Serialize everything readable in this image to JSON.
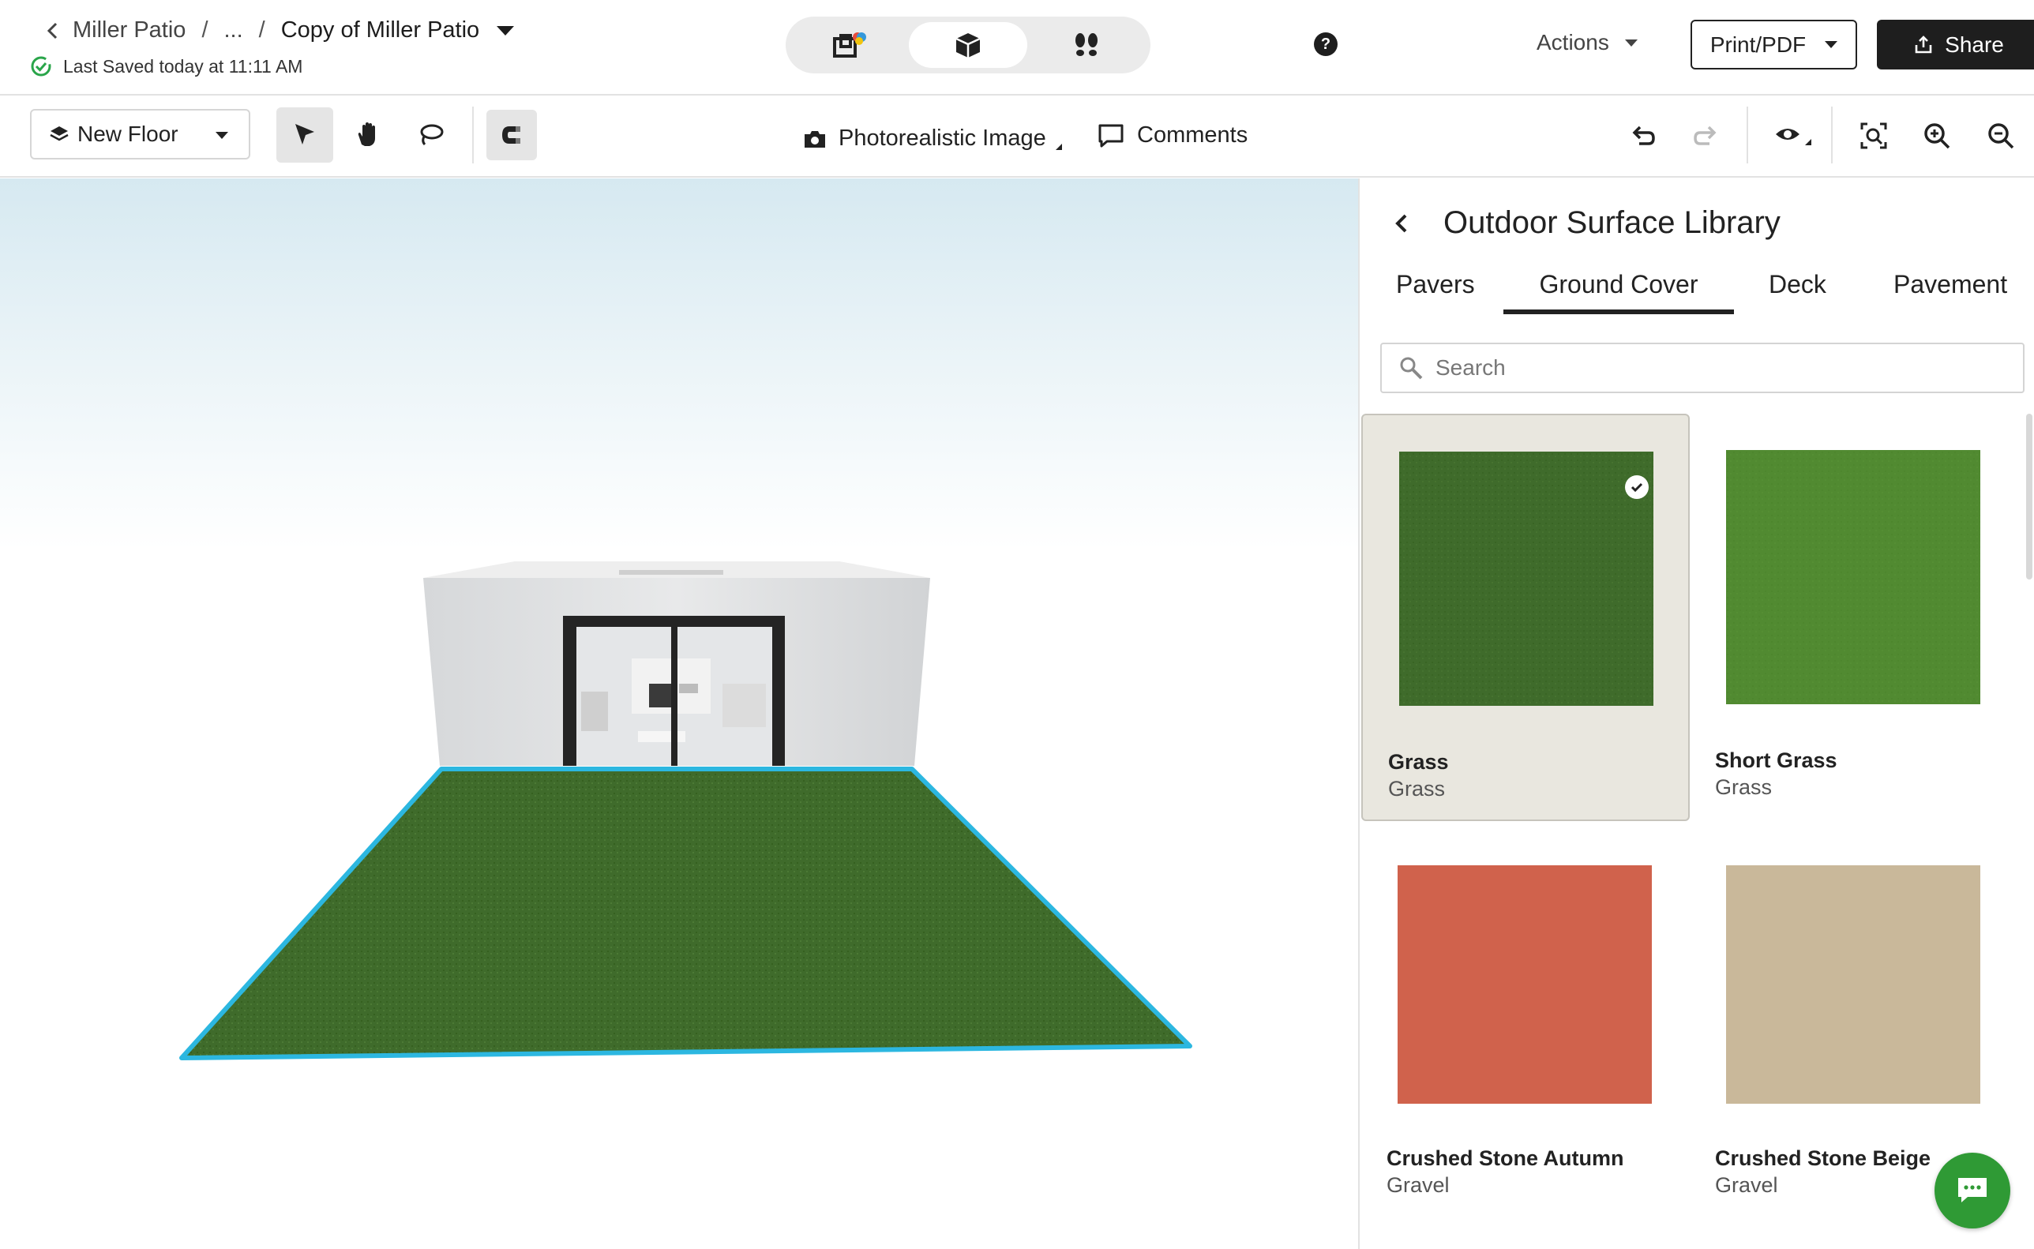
{
  "header": {
    "breadcrumb_parent": "Miller Patio",
    "breadcrumb_ellipsis": "...",
    "breadcrumb_separator": "/",
    "project_title": "Copy of Miller Patio",
    "save_status": "Last Saved today at 11:11 AM",
    "mode_icons": [
      "2d-floorplan-icon",
      "3d-box-icon",
      "walkthrough-footsteps-icon"
    ],
    "active_mode": "3d-box-icon",
    "help_label": "?",
    "actions_label": "Actions",
    "print_label": "Print/PDF",
    "share_label": "Share"
  },
  "toolbar": {
    "floor_label": "New Floor",
    "photo_label": "Photorealistic Image",
    "comments_label": "Comments"
  },
  "panel": {
    "title": "Outdoor Surface Library",
    "tabs": [
      {
        "label": "Pavers",
        "active": false
      },
      {
        "label": "Ground Cover",
        "active": true
      },
      {
        "label": "Deck",
        "active": false
      },
      {
        "label": "Pavement",
        "active": false
      }
    ],
    "search_placeholder": "Search",
    "items": [
      {
        "name": "Grass",
        "category": "Grass",
        "selected": true,
        "color": "#3e6b2a"
      },
      {
        "name": "Short Grass",
        "category": "Grass",
        "selected": false,
        "color": "#5a9a34"
      },
      {
        "name": "Crushed Stone Autumn",
        "category": "Gravel",
        "selected": false,
        "color": "#d0624c"
      },
      {
        "name": "Crushed Stone Beige",
        "category": "Gravel",
        "selected": false,
        "color": "#c9b89a"
      }
    ]
  },
  "colors": {
    "selection_outline": "#2cb7e0",
    "chat_button": "#2f9a35",
    "save_ok": "#2aa54a"
  }
}
